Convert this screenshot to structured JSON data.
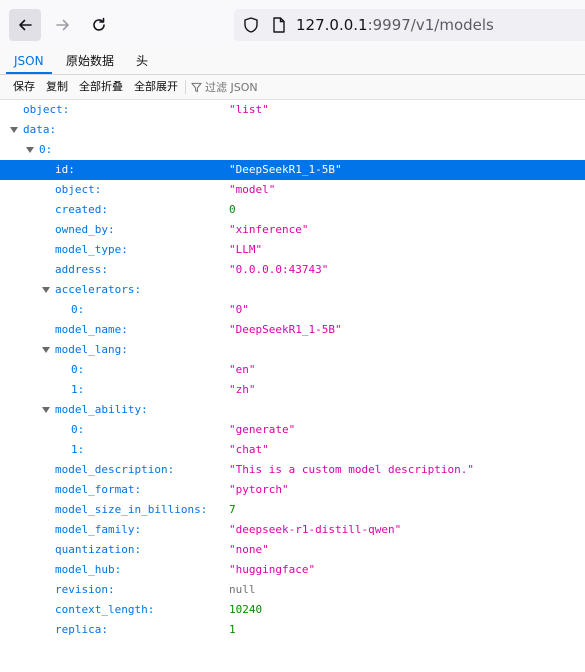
{
  "browser": {
    "url_host": "127.0.0.1",
    "url_rest": ":9997/v1/models"
  },
  "tabs": [
    "JSON",
    "原始数据",
    "头"
  ],
  "toolbar": {
    "save": "保存",
    "copy": "复制",
    "collapse_all": "全部折叠",
    "expand_all": "全部展开",
    "filter_placeholder": "过滤 JSON"
  },
  "rows": [
    {
      "key": "object:",
      "value": "\"list\"",
      "type": "string",
      "depth": 0
    },
    {
      "key": "data:",
      "value": "",
      "type": "expander",
      "depth": 0
    },
    {
      "key": "0:",
      "value": "",
      "type": "expander",
      "depth": 1
    },
    {
      "key": "id:",
      "value": "\"DeepSeekR1_1-5B\"",
      "type": "string",
      "depth": 2,
      "selected": true
    },
    {
      "key": "object:",
      "value": "\"model\"",
      "type": "string",
      "depth": 2
    },
    {
      "key": "created:",
      "value": "0",
      "type": "number",
      "depth": 2
    },
    {
      "key": "owned_by:",
      "value": "\"xinference\"",
      "type": "string",
      "depth": 2
    },
    {
      "key": "model_type:",
      "value": "\"LLM\"",
      "type": "string",
      "depth": 2
    },
    {
      "key": "address:",
      "value": "\"0.0.0.0:43743\"",
      "type": "string",
      "depth": 2
    },
    {
      "key": "accelerators:",
      "value": "",
      "type": "expander",
      "depth": 2
    },
    {
      "key": "0:",
      "value": "\"0\"",
      "type": "string",
      "depth": 3
    },
    {
      "key": "model_name:",
      "value": "\"DeepSeekR1_1-5B\"",
      "type": "string",
      "depth": 2
    },
    {
      "key": "model_lang:",
      "value": "",
      "type": "expander",
      "depth": 2
    },
    {
      "key": "0:",
      "value": "\"en\"",
      "type": "string",
      "depth": 3
    },
    {
      "key": "1:",
      "value": "\"zh\"",
      "type": "string",
      "depth": 3
    },
    {
      "key": "model_ability:",
      "value": "",
      "type": "expander",
      "depth": 2
    },
    {
      "key": "0:",
      "value": "\"generate\"",
      "type": "string",
      "depth": 3
    },
    {
      "key": "1:",
      "value": "\"chat\"",
      "type": "string",
      "depth": 3
    },
    {
      "key": "model_description:",
      "value": "\"This is a custom model description.\"",
      "type": "string",
      "depth": 2
    },
    {
      "key": "model_format:",
      "value": "\"pytorch\"",
      "type": "string",
      "depth": 2
    },
    {
      "key": "model_size_in_billions:",
      "value": "7",
      "type": "number",
      "depth": 2
    },
    {
      "key": "model_family:",
      "value": "\"deepseek-r1-distill-qwen\"",
      "type": "string",
      "depth": 2
    },
    {
      "key": "quantization:",
      "value": "\"none\"",
      "type": "string",
      "depth": 2
    },
    {
      "key": "model_hub:",
      "value": "\"huggingface\"",
      "type": "string",
      "depth": 2
    },
    {
      "key": "revision:",
      "value": "null",
      "type": "null",
      "depth": 2
    },
    {
      "key": "context_length:",
      "value": "10240",
      "type": "number",
      "depth": 2
    },
    {
      "key": "replica:",
      "value": "1",
      "type": "number",
      "depth": 2
    }
  ]
}
